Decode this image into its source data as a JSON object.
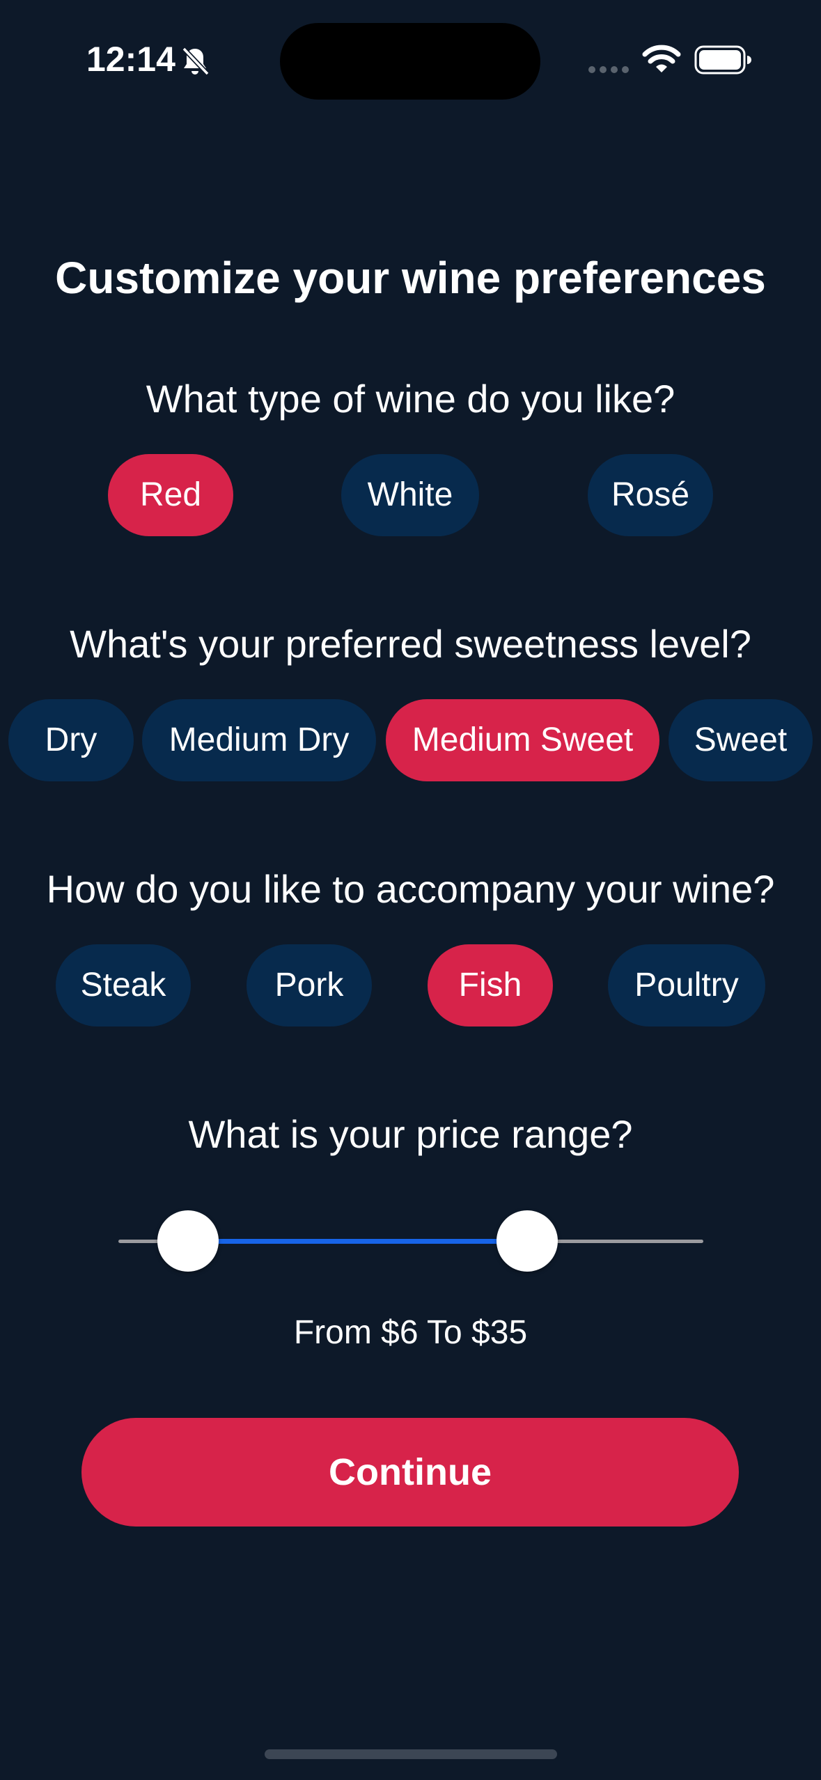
{
  "status_bar": {
    "time": "12:14",
    "icons": [
      "bell-slash-icon",
      "signal-icon",
      "wifi-icon",
      "battery-icon"
    ]
  },
  "page_title": "Customize your wine preferences",
  "wine_type": {
    "question": "What type of wine do you like?",
    "options": [
      "Red",
      "White",
      "Rosé"
    ],
    "selected": "Red"
  },
  "sweetness": {
    "question": "What's your preferred sweetness level?",
    "options": [
      "Dry",
      "Medium Dry",
      "Medium Sweet",
      "Sweet"
    ],
    "selected": "Medium Sweet"
  },
  "pairing": {
    "question": "How do you like to accompany your wine?",
    "options": [
      "Steak",
      "Pork",
      "Fish",
      "Poultry"
    ],
    "selected": "Fish"
  },
  "price": {
    "question": "What is your price range?",
    "range_label": "From $6 To $35",
    "min_value": 6,
    "max_value": 35
  },
  "continue_label": "Continue",
  "colors": {
    "background": "#0d1929",
    "chip": "#072a4d",
    "accent": "#d7234a",
    "slider_fill": "#1764e8"
  }
}
